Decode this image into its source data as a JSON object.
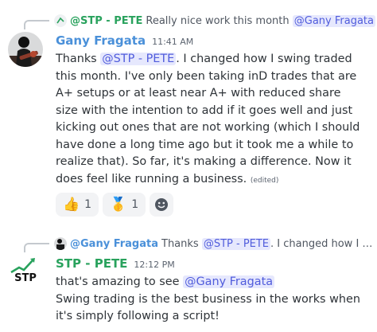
{
  "messages": [
    {
      "reply": {
        "author": "@STP - PETE",
        "text_before": "Really nice work this month ",
        "mention": "@Gany Fragata",
        "colors": {
          "author": "#29a25d"
        }
      },
      "author": "Gany Fragata",
      "time": "11:41 AM",
      "body": {
        "prefix": "Thanks ",
        "mention": "@STP - PETE",
        "text": ". I changed how I swing traded this month. I've only been taking inD trades that are A+ setups or at least near A+ with reduced share size with the intention to add if it goes well and just kicking out ones that are not working (which I should have done a long time ago but it took me a while to realize that). So far, it's making a difference. Now it does feel like running a business.",
        "edited": "(edited)"
      },
      "colors": {
        "author": "#4a90d9"
      },
      "reactions": [
        {
          "icon": "thumbs-up",
          "emoji": "👍",
          "count": "1"
        },
        {
          "icon": "first-place-medal",
          "emoji": "🥇",
          "count": "1"
        }
      ]
    },
    {
      "reply": {
        "author": "@Gany Fragata",
        "text_before": "Thanks ",
        "mention": "@STP - PETE",
        "text_after": ". I changed how I s...",
        "colors": {
          "author": "#4a90d9"
        }
      },
      "author": "STP - PETE",
      "time": "12:12 PM",
      "avatar_text": "STP",
      "body": {
        "prefix": "that's amazing to see ",
        "mention": "@Gany Fragata",
        "line2": "Swing trading is the best business in the works when it's simply following a script!"
      },
      "colors": {
        "author": "#29a25d"
      }
    }
  ]
}
